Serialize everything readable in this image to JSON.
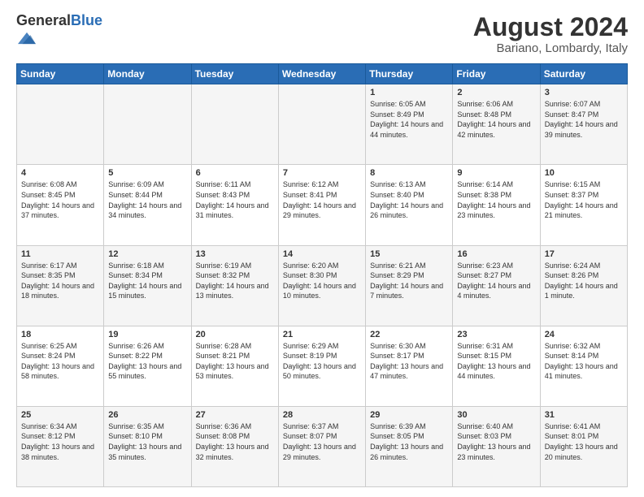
{
  "header": {
    "logo_general": "General",
    "logo_blue": "Blue",
    "month_year": "August 2024",
    "location": "Bariano, Lombardy, Italy"
  },
  "days_of_week": [
    "Sunday",
    "Monday",
    "Tuesday",
    "Wednesday",
    "Thursday",
    "Friday",
    "Saturday"
  ],
  "weeks": [
    [
      {
        "day": "",
        "info": ""
      },
      {
        "day": "",
        "info": ""
      },
      {
        "day": "",
        "info": ""
      },
      {
        "day": "",
        "info": ""
      },
      {
        "day": "1",
        "info": "Sunrise: 6:05 AM\nSunset: 8:49 PM\nDaylight: 14 hours and 44 minutes."
      },
      {
        "day": "2",
        "info": "Sunrise: 6:06 AM\nSunset: 8:48 PM\nDaylight: 14 hours and 42 minutes."
      },
      {
        "day": "3",
        "info": "Sunrise: 6:07 AM\nSunset: 8:47 PM\nDaylight: 14 hours and 39 minutes."
      }
    ],
    [
      {
        "day": "4",
        "info": "Sunrise: 6:08 AM\nSunset: 8:45 PM\nDaylight: 14 hours and 37 minutes."
      },
      {
        "day": "5",
        "info": "Sunrise: 6:09 AM\nSunset: 8:44 PM\nDaylight: 14 hours and 34 minutes."
      },
      {
        "day": "6",
        "info": "Sunrise: 6:11 AM\nSunset: 8:43 PM\nDaylight: 14 hours and 31 minutes."
      },
      {
        "day": "7",
        "info": "Sunrise: 6:12 AM\nSunset: 8:41 PM\nDaylight: 14 hours and 29 minutes."
      },
      {
        "day": "8",
        "info": "Sunrise: 6:13 AM\nSunset: 8:40 PM\nDaylight: 14 hours and 26 minutes."
      },
      {
        "day": "9",
        "info": "Sunrise: 6:14 AM\nSunset: 8:38 PM\nDaylight: 14 hours and 23 minutes."
      },
      {
        "day": "10",
        "info": "Sunrise: 6:15 AM\nSunset: 8:37 PM\nDaylight: 14 hours and 21 minutes."
      }
    ],
    [
      {
        "day": "11",
        "info": "Sunrise: 6:17 AM\nSunset: 8:35 PM\nDaylight: 14 hours and 18 minutes."
      },
      {
        "day": "12",
        "info": "Sunrise: 6:18 AM\nSunset: 8:34 PM\nDaylight: 14 hours and 15 minutes."
      },
      {
        "day": "13",
        "info": "Sunrise: 6:19 AM\nSunset: 8:32 PM\nDaylight: 14 hours and 13 minutes."
      },
      {
        "day": "14",
        "info": "Sunrise: 6:20 AM\nSunset: 8:30 PM\nDaylight: 14 hours and 10 minutes."
      },
      {
        "day": "15",
        "info": "Sunrise: 6:21 AM\nSunset: 8:29 PM\nDaylight: 14 hours and 7 minutes."
      },
      {
        "day": "16",
        "info": "Sunrise: 6:23 AM\nSunset: 8:27 PM\nDaylight: 14 hours and 4 minutes."
      },
      {
        "day": "17",
        "info": "Sunrise: 6:24 AM\nSunset: 8:26 PM\nDaylight: 14 hours and 1 minute."
      }
    ],
    [
      {
        "day": "18",
        "info": "Sunrise: 6:25 AM\nSunset: 8:24 PM\nDaylight: 13 hours and 58 minutes."
      },
      {
        "day": "19",
        "info": "Sunrise: 6:26 AM\nSunset: 8:22 PM\nDaylight: 13 hours and 55 minutes."
      },
      {
        "day": "20",
        "info": "Sunrise: 6:28 AM\nSunset: 8:21 PM\nDaylight: 13 hours and 53 minutes."
      },
      {
        "day": "21",
        "info": "Sunrise: 6:29 AM\nSunset: 8:19 PM\nDaylight: 13 hours and 50 minutes."
      },
      {
        "day": "22",
        "info": "Sunrise: 6:30 AM\nSunset: 8:17 PM\nDaylight: 13 hours and 47 minutes."
      },
      {
        "day": "23",
        "info": "Sunrise: 6:31 AM\nSunset: 8:15 PM\nDaylight: 13 hours and 44 minutes."
      },
      {
        "day": "24",
        "info": "Sunrise: 6:32 AM\nSunset: 8:14 PM\nDaylight: 13 hours and 41 minutes."
      }
    ],
    [
      {
        "day": "25",
        "info": "Sunrise: 6:34 AM\nSunset: 8:12 PM\nDaylight: 13 hours and 38 minutes."
      },
      {
        "day": "26",
        "info": "Sunrise: 6:35 AM\nSunset: 8:10 PM\nDaylight: 13 hours and 35 minutes."
      },
      {
        "day": "27",
        "info": "Sunrise: 6:36 AM\nSunset: 8:08 PM\nDaylight: 13 hours and 32 minutes."
      },
      {
        "day": "28",
        "info": "Sunrise: 6:37 AM\nSunset: 8:07 PM\nDaylight: 13 hours and 29 minutes."
      },
      {
        "day": "29",
        "info": "Sunrise: 6:39 AM\nSunset: 8:05 PM\nDaylight: 13 hours and 26 minutes."
      },
      {
        "day": "30",
        "info": "Sunrise: 6:40 AM\nSunset: 8:03 PM\nDaylight: 13 hours and 23 minutes."
      },
      {
        "day": "31",
        "info": "Sunrise: 6:41 AM\nSunset: 8:01 PM\nDaylight: 13 hours and 20 minutes."
      }
    ]
  ]
}
